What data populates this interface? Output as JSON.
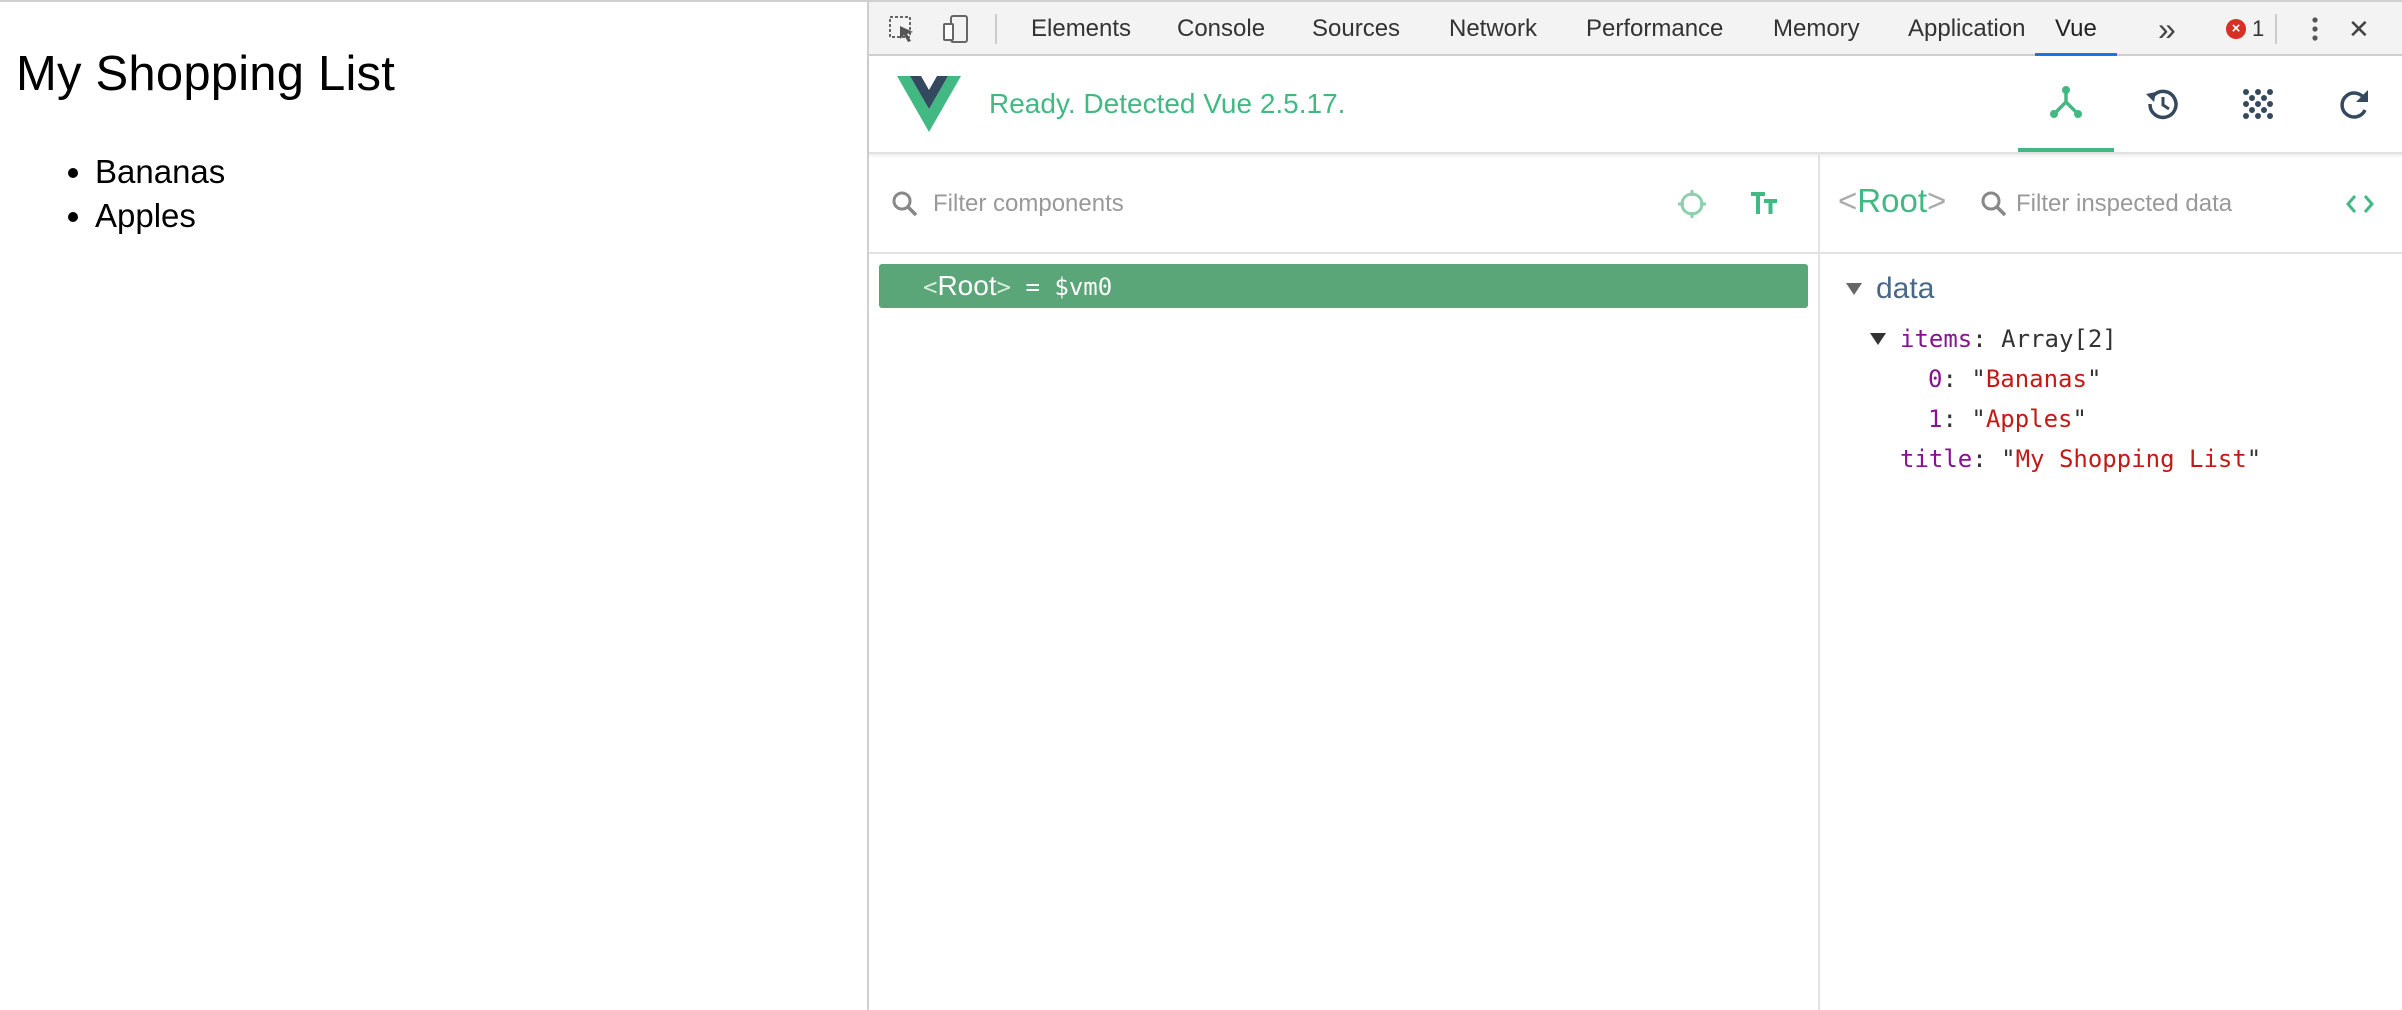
{
  "page": {
    "title": "My Shopping List",
    "items": [
      "Bananas",
      "Apples"
    ]
  },
  "devtools": {
    "tabs": [
      "Elements",
      "Console",
      "Sources",
      "Network",
      "Performance",
      "Memory",
      "Application",
      "Vue"
    ],
    "active_tab": "Vue",
    "more_glyph": "»",
    "error_count": "1",
    "error_glyph": "×",
    "close_glyph": "✕",
    "vue": {
      "status": "Ready. Detected Vue 2.5.17.",
      "filter_components_placeholder": "Filter components",
      "filter_data_placeholder": "Filter inspected data",
      "tree": {
        "open": "<",
        "name": "Root",
        "close": ">",
        "assign": " = $vm0"
      },
      "inspector": {
        "open": "<",
        "name": "Root",
        "close": ">",
        "section": "data",
        "items_key": "items",
        "items_type": "Array[2]",
        "item0_key": "0",
        "item0_val": "Bananas",
        "item1_key": "1",
        "item1_val": "Apples",
        "title_key": "title",
        "title_val": "My Shopping List"
      }
    },
    "colors": {
      "vue_green": "#42b983",
      "selected_row": "#5aa678",
      "active_tab_underline": "#1a73e8",
      "key_purple": "#881391",
      "string_red": "#c41a16"
    }
  }
}
